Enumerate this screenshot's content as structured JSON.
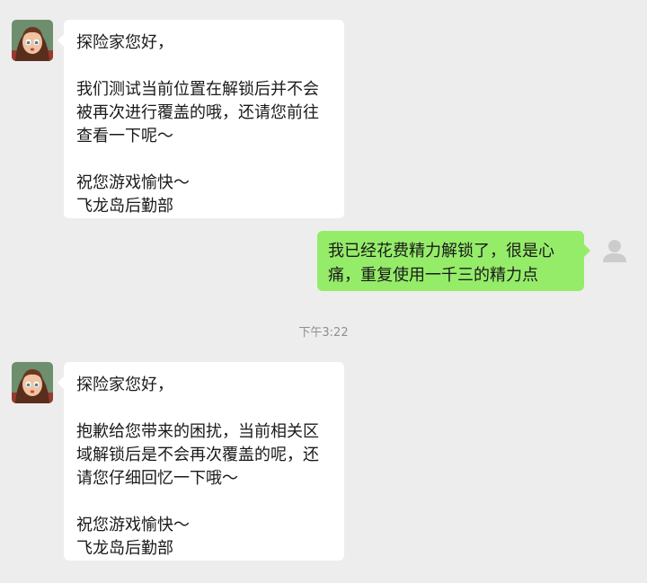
{
  "messages": [
    {
      "sender": "飞龙岛后勤部",
      "direction": "incoming",
      "lines": [
        "探险家您好，",
        "",
        "我们测试当前位置在解锁后并不会",
        "被再次进行覆盖的哦，还请您前往",
        "查看一下呢～",
        "",
        "祝您游戏愉快～",
        "飞龙岛后勤部"
      ]
    },
    {
      "sender": "me",
      "direction": "outgoing",
      "lines": [
        "我已经花费精力解锁了，很是心",
        "痛，重复使用一千三的精力点"
      ]
    },
    {
      "sender": "飞龙岛后勤部",
      "direction": "incoming",
      "lines": [
        "探险家您好，",
        "",
        "抱歉给您带来的困扰，当前相关区",
        "域解锁后是不会再次覆盖的呢，还",
        "请您仔细回忆一下哦～",
        "",
        "祝您游戏愉快～",
        "飞龙岛后勤部"
      ]
    }
  ],
  "timestamp": "下午3:22",
  "colors": {
    "background": "#ededed",
    "incoming_bubble": "#ffffff",
    "outgoing_bubble": "#95ec69",
    "timestamp_text": "#8f8f8f"
  },
  "icons": {
    "incoming_avatar": "character-portrait-avatar",
    "outgoing_avatar": "default-user-avatar"
  }
}
